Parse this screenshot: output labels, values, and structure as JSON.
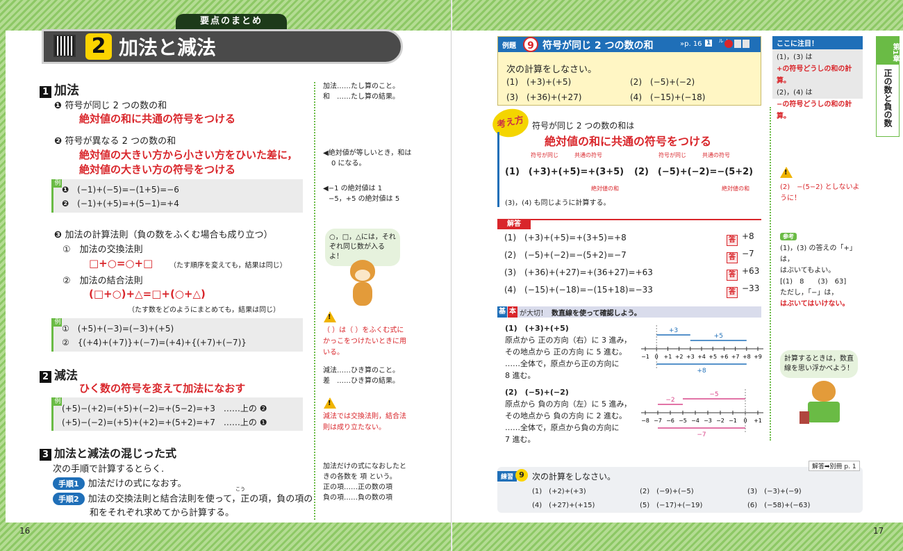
{
  "left": {
    "banner": "要点のまとめ",
    "chapter_no": "2",
    "title": "加法と減法",
    "page_no": "16",
    "s1": {
      "no": "1",
      "head": "加法",
      "r1_label": "符号が同じ 2 つの数の和",
      "r1_rule": "絶対値の和に共通の符号をつける",
      "r2_label": "符号が異なる 2 つの数の和",
      "r2_rule1": "絶対値の大きい方から小さい方をひいた差に，",
      "r2_rule2": "絶対値の大きい方の符号をつける",
      "ex1_tag": "例",
      "ex1": [
        "(−1)+(−5)=−(1+5)=−6",
        "(−1)+(+5)=+(5−1)=+4"
      ],
      "r3_label": "加法の計算法則（負の数をふくむ場合も成り立つ）",
      "comm_label": "①　加法の交換法則",
      "comm_formula": "□+○=○+□",
      "comm_note": "（たす順序を変えても，結果は同じ）",
      "assoc_label": "②　加法の結合法則",
      "assoc_formula": "(□+○)+△=□+(○+△)",
      "assoc_note": "（たす数をどのようにまとめても，結果は同じ）",
      "ex2_tag": "例",
      "ex2": [
        "①　(+5)+(−3)=(−3)+(+5)",
        "②　{(+4)+(+7)}+(−7)=(+4)+{(+7)+(−7)}"
      ]
    },
    "s2": {
      "no": "2",
      "head": "減法",
      "rule": "ひく数の符号を変えて加法になおす",
      "ex_tag": "例",
      "ex": [
        "(+5)−(+2)=(+5)+(−2)=+(5−2)=+3　……上の ❷",
        "(+5)−(−2)=(+5)+(+2)=+(5+2)=+7　……上の ❶"
      ]
    },
    "s3": {
      "no": "3",
      "head": "加法と減法の混じった式",
      "intro": "次の手順で計算するとらく.",
      "step1_tag": "手順1",
      "step1": "加法だけの式になおす。",
      "step2_tag": "手順2",
      "step2a": "加法の交換法則と結合法則を使って，正の項，負の項の",
      "step2b": "和をそれぞれ求めてから計算する。",
      "furigana": "こう"
    },
    "side": {
      "def1": "加法……たし算のこと。",
      "def2": "和　……たし算の結果。",
      "note1a": "◀絶対値が等しいとき，和は",
      "note1b": "0 になる。",
      "note2a": "◀−1 の絶対値は 1",
      "note2b": "−5，+5 の絶対値は 5",
      "bubble": "○，□，△には，それぞれ同じ数が入るよ！",
      "warn1": "（ ）は（ ）をふくむ式にかっこをつけたいときに用いる。",
      "def3": "減法……ひき算のこと。",
      "def4": "差　……ひき算の結果。",
      "warn2": "減法では交換法則，結合法則は成り立たない。",
      "term1": "加法だけの式になおしたときの各数を 項 という。",
      "term2": "正の項……正の数の項",
      "term3": "負の項……負の数の項"
    }
  },
  "right": {
    "page_no": "17",
    "chapter_tab": {
      "label": "第1章",
      "title": "正の数と負の数"
    },
    "ex_head": {
      "tag": "例題",
      "no": "9",
      "title": "符号が同じ 2 つの数の和",
      "ref": "»p. 16",
      "ref_no": "1",
      "level": "レベル"
    },
    "ex_prompt": "次の計算をしなさい。",
    "problems": [
      "(1)　(+3)+(+5)",
      "(2)　(−5)+(−2)",
      "(3)　(+36)+(+27)",
      "(4)　(−15)+(−18)"
    ],
    "kangae": "考え方",
    "k_line": "符号が同じ 2 つの数の和は",
    "k_rule": "絶対値の和に共通の符号をつける",
    "k_small1": "符号が同じ",
    "k_small2": "共通の符号",
    "k_small3": "絶対値の和",
    "k_ex1": "(1)　(+3)+(+5)=+(3+5)",
    "k_ex2": "(2)　(−5)+(−2)=−(5+2)",
    "k_also": "(3)，(4) も同じように計算する。",
    "kaito": "解答",
    "answers": [
      {
        "q": "(1)",
        "expr": "(+3)+(+5)=+(3+5)=+8",
        "ans": "+8"
      },
      {
        "q": "(2)",
        "expr": "(−5)+(−2)=−(5+2)=−7",
        "ans": "−7"
      },
      {
        "q": "(3)",
        "expr": "(+36)+(+27)=+(36+27)=+63",
        "ans": "+63"
      },
      {
        "q": "(4)",
        "expr": "(−15)+(−18)=−(15+18)=−33",
        "ans": "−33"
      }
    ],
    "ans_tag": "答",
    "kihon": {
      "t1": "基",
      "t2": "本",
      "rest": "が大切！",
      "hl": "数直線を使って確認しよう。"
    },
    "nl1": {
      "head": "(1)　(+3)+(+5)",
      "l1": "原点から 正の方向（右）に 3 進み，",
      "l2": "その地点から 正の方向 に 5 進む。",
      "l3": "……全体で，原点から正の方向に",
      "l4": "8 進む。",
      "arr1": "+3",
      "arr2": "+5",
      "arr3": "+8",
      "ticks": [
        "−1",
        "0",
        "+1",
        "+2",
        "+3",
        "+4",
        "+5",
        "+6",
        "+7",
        "+8",
        "+9"
      ]
    },
    "nl2": {
      "head": "(2)　(−5)+(−2)",
      "l1": "原点から 負の方向（左）に 5 進み，",
      "l2": "その地点から 負の方向 に 2 進む。",
      "l3": "……全体で，原点から負の方向に",
      "l4": "7 進む。",
      "arr1": "−5",
      "arr2": "−2",
      "arr3": "−7",
      "ticks": [
        "−8",
        "−7",
        "−6",
        "−5",
        "−4",
        "−3",
        "−2",
        "−1",
        "0",
        "+1"
      ]
    },
    "renshu": {
      "tag": "練習",
      "no": "9",
      "prompt": "次の計算をしなさい。",
      "ref": "解答➡別冊 p. 1",
      "items": [
        "(1)　(+2)+(+3)",
        "(2)　(−9)+(−5)",
        "(3)　(−3)+(−9)",
        "(4)　(+27)+(+15)",
        "(5)　(−17)+(−19)",
        "(6)　(−58)+(−63)"
      ]
    },
    "side": {
      "attn": "ここに注目！",
      "attn1": "(1)，(3) は",
      "attn2": "+の符号どうしの和の計算。",
      "attn3": "(2)，(4) は",
      "attn4": "−の符号どうしの和の計算。",
      "warn": "(2)　−(5−2) としないように！",
      "sanko": "参考",
      "s1": "(1)，(3) の答えの「+」は，",
      "s2": "はぶいてもよい。",
      "s3": "[(1)　8　　(3)　63]",
      "s4": "ただし，「−」は，",
      "s5": "はぶいてはいけない。",
      "bubble": "計算するときは，数直線を思い浮かべよう！"
    }
  },
  "colors": {
    "green": "#6abb45",
    "red": "#d9262b",
    "blue": "#1f6fb8",
    "pink": "#d9478a"
  }
}
